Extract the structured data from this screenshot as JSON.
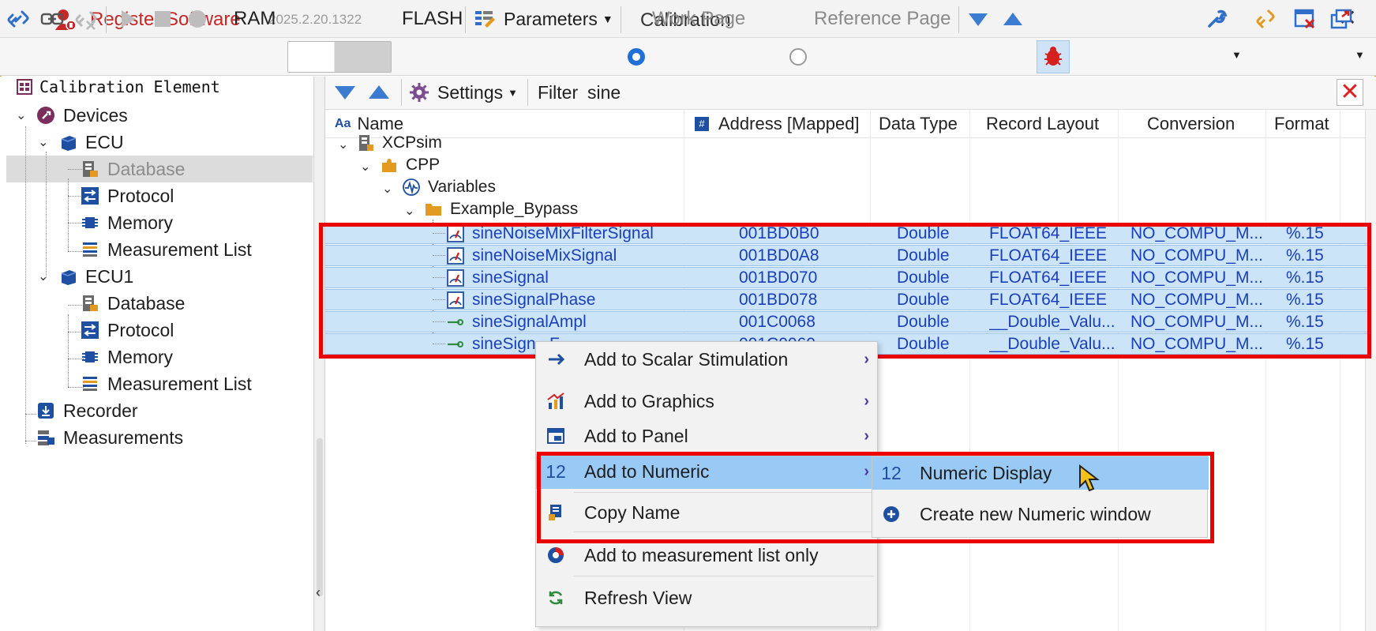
{
  "titlebar": {
    "app_name": "Register Software",
    "version": "2025.2.20.1322",
    "window_title": "Calibration",
    "close_label": "✕"
  },
  "toolbar": {
    "ram_label": "RAM",
    "flash_label": "FLASH",
    "parameters_label": "Parameters",
    "work_page_label": "Work Page",
    "reference_page_label": "Reference Page",
    "work_page_selected": true
  },
  "tree": {
    "header": "Calibration Element",
    "items": [
      {
        "label": "Devices"
      },
      {
        "label": "ECU"
      },
      {
        "label": "Database",
        "selected": true
      },
      {
        "label": "Protocol"
      },
      {
        "label": "Memory"
      },
      {
        "label": "Measurement List"
      },
      {
        "label": "ECU1"
      },
      {
        "label": "Database"
      },
      {
        "label": "Protocol"
      },
      {
        "label": "Memory"
      },
      {
        "label": "Measurement List"
      },
      {
        "label": "Recorder"
      },
      {
        "label": "Measurements"
      }
    ]
  },
  "panel": {
    "settings_label": "Settings",
    "filter_label": "Filter",
    "filter_value": "sine"
  },
  "grid": {
    "columns": [
      "Name",
      "Address [Mapped]",
      "Data Type",
      "Record Layout",
      "Conversion",
      "Format"
    ],
    "groups": [
      {
        "label": "XCPsim"
      },
      {
        "label": "CPP"
      },
      {
        "label": "Variables"
      },
      {
        "label": "Example_Bypass"
      }
    ],
    "rows": [
      {
        "name": "sineNoiseMixFilterSignal",
        "address": "001BD0B0",
        "type": "Double",
        "layout": "FLOAT64_IEEE",
        "conversion": "NO_COMPU_M...",
        "format": "%.15"
      },
      {
        "name": "sineNoiseMixSignal",
        "address": "001BD0A8",
        "type": "Double",
        "layout": "FLOAT64_IEEE",
        "conversion": "NO_COMPU_M...",
        "format": "%.15"
      },
      {
        "name": "sineSignal",
        "address": "001BD070",
        "type": "Double",
        "layout": "FLOAT64_IEEE",
        "conversion": "NO_COMPU_M...",
        "format": "%.15"
      },
      {
        "name": "sineSignalPhase",
        "address": "001BD078",
        "type": "Double",
        "layout": "FLOAT64_IEEE",
        "conversion": "NO_COMPU_M...",
        "format": "%.15"
      },
      {
        "name": "sineSignalAmpl",
        "address": "001C0068",
        "type": "Double",
        "layout": "__Double_Valu...",
        "conversion": "NO_COMPU_M...",
        "format": "%.15"
      },
      {
        "name": "sineSign...F...",
        "address": "001C0060",
        "type": "Double",
        "layout": "__Double_Valu...",
        "conversion": "NO_COMPU_M...",
        "format": "%.15"
      }
    ]
  },
  "context_menu": {
    "items": [
      {
        "label": "Add to Scalar Stimulation",
        "has_submenu": true
      },
      {
        "label": "Add to Graphics",
        "has_submenu": true
      },
      {
        "label": "Add to Panel",
        "has_submenu": true
      },
      {
        "label": "Add to Numeric",
        "has_submenu": true,
        "highlighted": true,
        "icon_text": "12"
      },
      {
        "label": "Copy Name"
      },
      {
        "label": "Add to measurement list only"
      },
      {
        "label": "Refresh View"
      }
    ]
  },
  "submenu": {
    "items": [
      {
        "label": "Numeric Display",
        "icon_text": "12",
        "highlighted": true
      },
      {
        "label": "Create new Numeric window"
      }
    ]
  },
  "colors": {
    "accent": "#1f6fd6",
    "selection": "#cce4f7",
    "menu_highlight": "#99c9f5",
    "annotation_red": "#ea0000",
    "row_text": "#1a3fb8"
  }
}
